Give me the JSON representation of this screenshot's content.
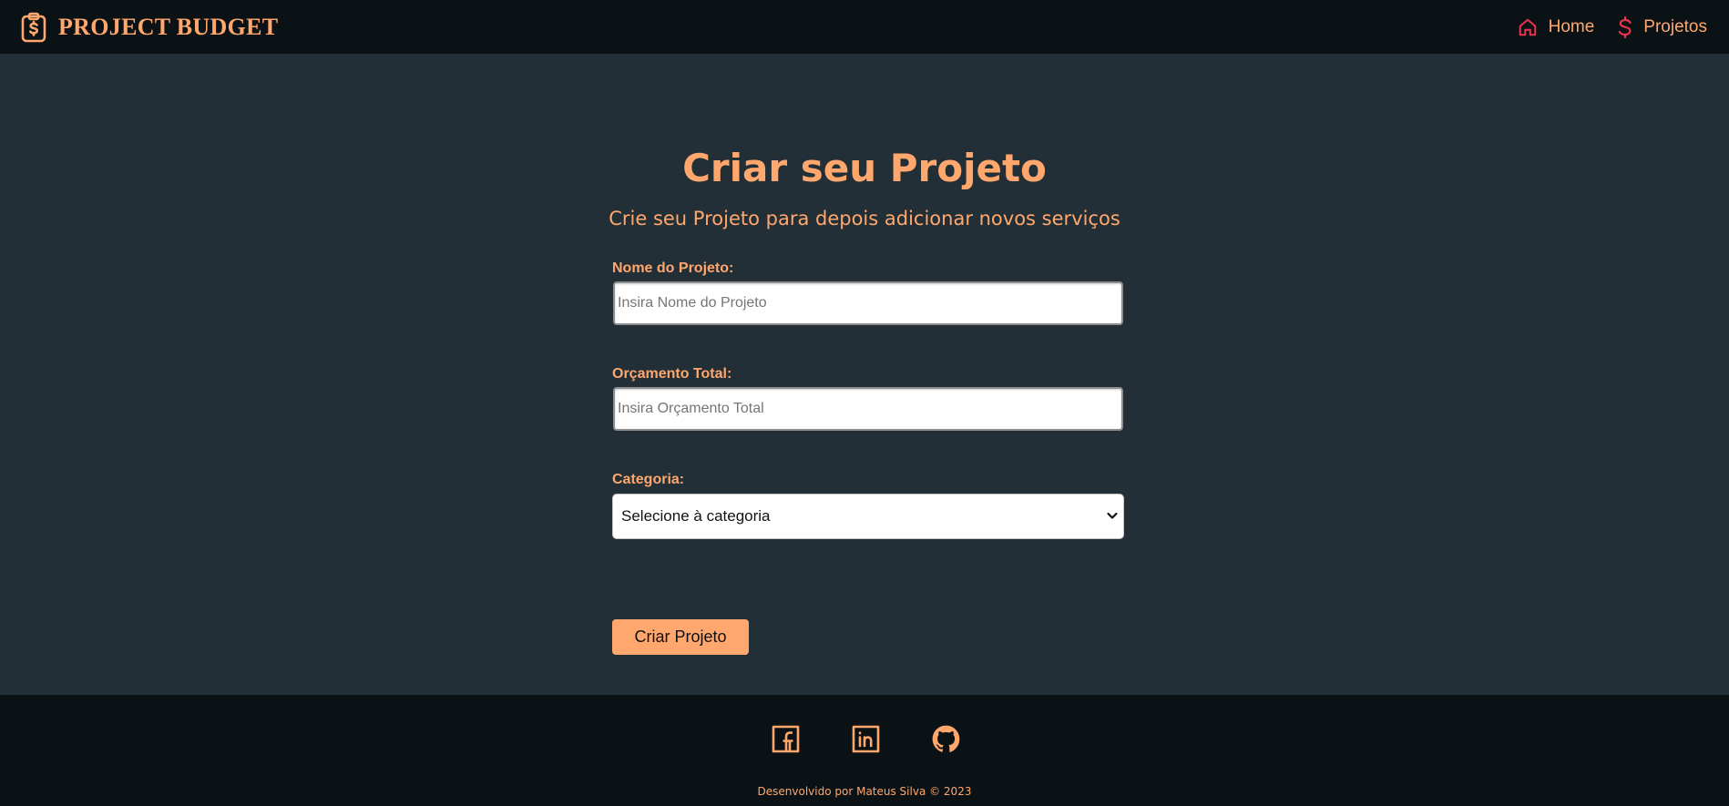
{
  "header": {
    "brand": "PROJECT BUDGET",
    "brand_icon": "clipboard-dollar-icon",
    "nav": [
      {
        "label": "Home",
        "icon": "home-icon"
      },
      {
        "label": "Projetos",
        "icon": "dollar-icon"
      }
    ]
  },
  "main": {
    "title": "Criar seu Projeto",
    "subtitle": "Crie seu Projeto para depois adicionar novos serviços",
    "form": {
      "name_label": "Nome do Projeto:",
      "name_placeholder": "Insira Nome do Projeto",
      "budget_label": "Orçamento Total:",
      "budget_placeholder": "Insira Orçamento Total",
      "category_label": "Categoria:",
      "category_selected": "Selecione à categoria",
      "submit_label": "Criar Projeto"
    }
  },
  "footer": {
    "social_icons": [
      "facebook-icon",
      "linkedin-icon",
      "github-icon"
    ],
    "copyright": "Desenvolvido por Mateus Silva © 2023"
  },
  "colors": {
    "accent": "#ffa76d",
    "nav_icon": "#e8344e",
    "navbar_bg": "#0b1216",
    "page_bg": "#232f36"
  }
}
